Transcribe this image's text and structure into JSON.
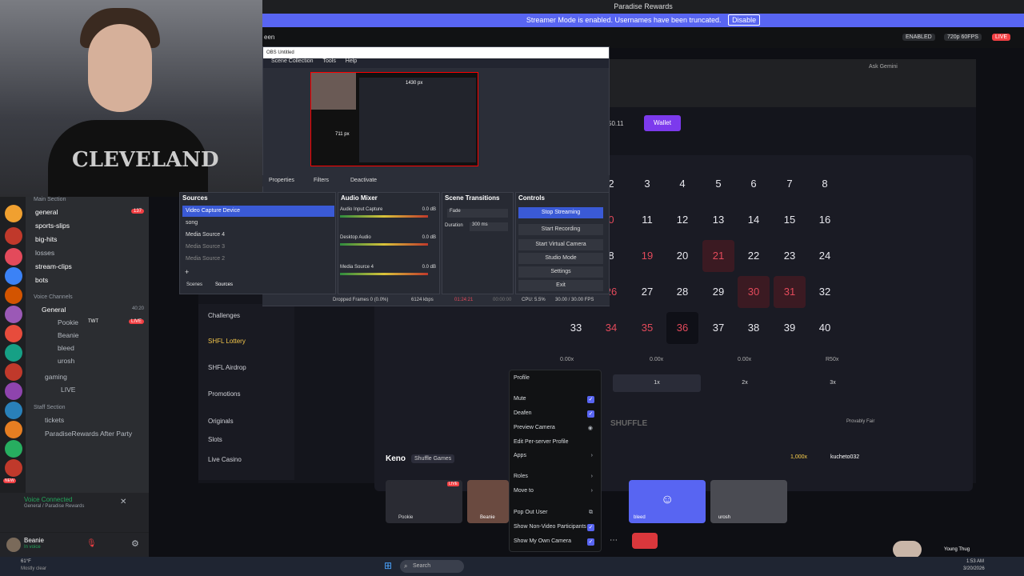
{
  "discord": {
    "title": "Paradise Rewards",
    "streamer_banner": "Streamer Mode is enabled. Usernames have been truncated.",
    "disable_label": "Disable",
    "enabled_label": "ENABLED",
    "quality_label": "720p 60FPS",
    "live_label": "LIVE",
    "channel_header_fragment": "een",
    "sections": {
      "main": "Main Section",
      "voice": "Voice Channels",
      "staff": "Staff Section"
    },
    "text_channels": [
      "general",
      "sports-slips",
      "big-hits",
      "losses",
      "stream-clips",
      "bots"
    ],
    "general_badge": "137",
    "voice_channel": "General",
    "voice_count": "40:20",
    "voice_users": [
      "Pookie",
      "Beanie",
      "bleed",
      "urosh"
    ],
    "pookie_tag": "TWT",
    "pookie_live": "LIVE",
    "other_channels": [
      "gaming",
      "LIVE"
    ],
    "staff_channels": [
      "tickets",
      "ParadiseRewards After Party"
    ],
    "new_badge": "NEW",
    "voice_connected": "Voice Connected",
    "voice_location": "General / Paradise Rewards",
    "user_name": "Beanie",
    "user_status": "In voice"
  },
  "obs": {
    "title": "OBS Untitled",
    "menu": [
      "Scene Collection",
      "Tools",
      "Help"
    ],
    "preview_labels": [
      "1430 px",
      "711 px"
    ],
    "toolbar": [
      "Properties",
      "Filters",
      "Deactivate"
    ],
    "sources_header": "Sources",
    "sources": [
      "Video Capture Device",
      "song",
      "Media Source 4",
      "Media Source 3",
      "Media Source 2"
    ],
    "tabs": [
      "Scenes",
      "Sources"
    ],
    "mixer_header": "Audio Mixer",
    "mixer": [
      {
        "name": "Audio Input Capture",
        "db": "0.0 dB"
      },
      {
        "name": "Desktop Audio",
        "db": "0.0 dB"
      },
      {
        "name": "Media Source 4",
        "db": "0.0 dB"
      }
    ],
    "transitions_header": "Scene Transitions",
    "transition": "Fade",
    "duration_label": "Duration",
    "duration": "300 ms",
    "controls_header": "Controls",
    "controls": [
      "Stop Streaming",
      "Start Recording",
      "Start Virtual Camera",
      "Studio Mode",
      "Settings",
      "Exit"
    ],
    "status": {
      "dropped": "Dropped Frames 0 (0.0%)",
      "kbps": "6124 kbps",
      "live": "01:24:21",
      "rec": "00:00:00",
      "cpu": "CPU: 5.5%",
      "fps": "30.00 / 30.00 FPS"
    }
  },
  "casino": {
    "wallet_label": "Wallet",
    "balance_fragment": "50.11",
    "ask_label": "Ask Gemini",
    "sidebar": [
      "Challenges",
      "SHFL Lottery",
      "SHFL Airdrop",
      "Promotions",
      "Originals",
      "Slots",
      "Live Casino"
    ],
    "numbers": [
      [
        "2",
        "3",
        "4",
        "5",
        "6",
        "7",
        "8"
      ],
      [
        "0",
        "11",
        "12",
        "13",
        "14",
        "15",
        "16"
      ],
      [
        "8",
        "19",
        "20",
        "21",
        "22",
        "23",
        "24"
      ],
      [
        "26",
        "27",
        "28",
        "29",
        "30",
        "31",
        "32"
      ],
      [
        "33",
        "34",
        "35",
        "36",
        "37",
        "38",
        "39",
        "40"
      ]
    ],
    "payouts": [
      "0.00x",
      "0.00x",
      "0.00x",
      "R50x"
    ],
    "multipliers": [
      "1x",
      "2x",
      "3x"
    ],
    "brand": "SHUFFLE",
    "provably_fair": "Provably Fair",
    "game_name": "Keno",
    "game_provider": "Shuffle Games",
    "bet_value": "1,000x",
    "player": "kucheto032"
  },
  "context_menu": {
    "items": [
      "Profile",
      "Mute",
      "Deafen",
      "Preview Camera",
      "Edit Per-server Profile",
      "Apps",
      "Roles",
      "Move to",
      "Pop Out User",
      "Show Non-Video Participants",
      "Show My Own Camera"
    ]
  },
  "call": {
    "tiles": [
      "Pookie",
      "Beanie",
      "bleed",
      "urosh"
    ],
    "live": "LIVE"
  },
  "taskbar": {
    "weather": "61°F",
    "weather_desc": "Mostly clear",
    "search": "Search",
    "time": "1:53 AM",
    "date": "3/20/2026",
    "music": "Young Thug"
  }
}
